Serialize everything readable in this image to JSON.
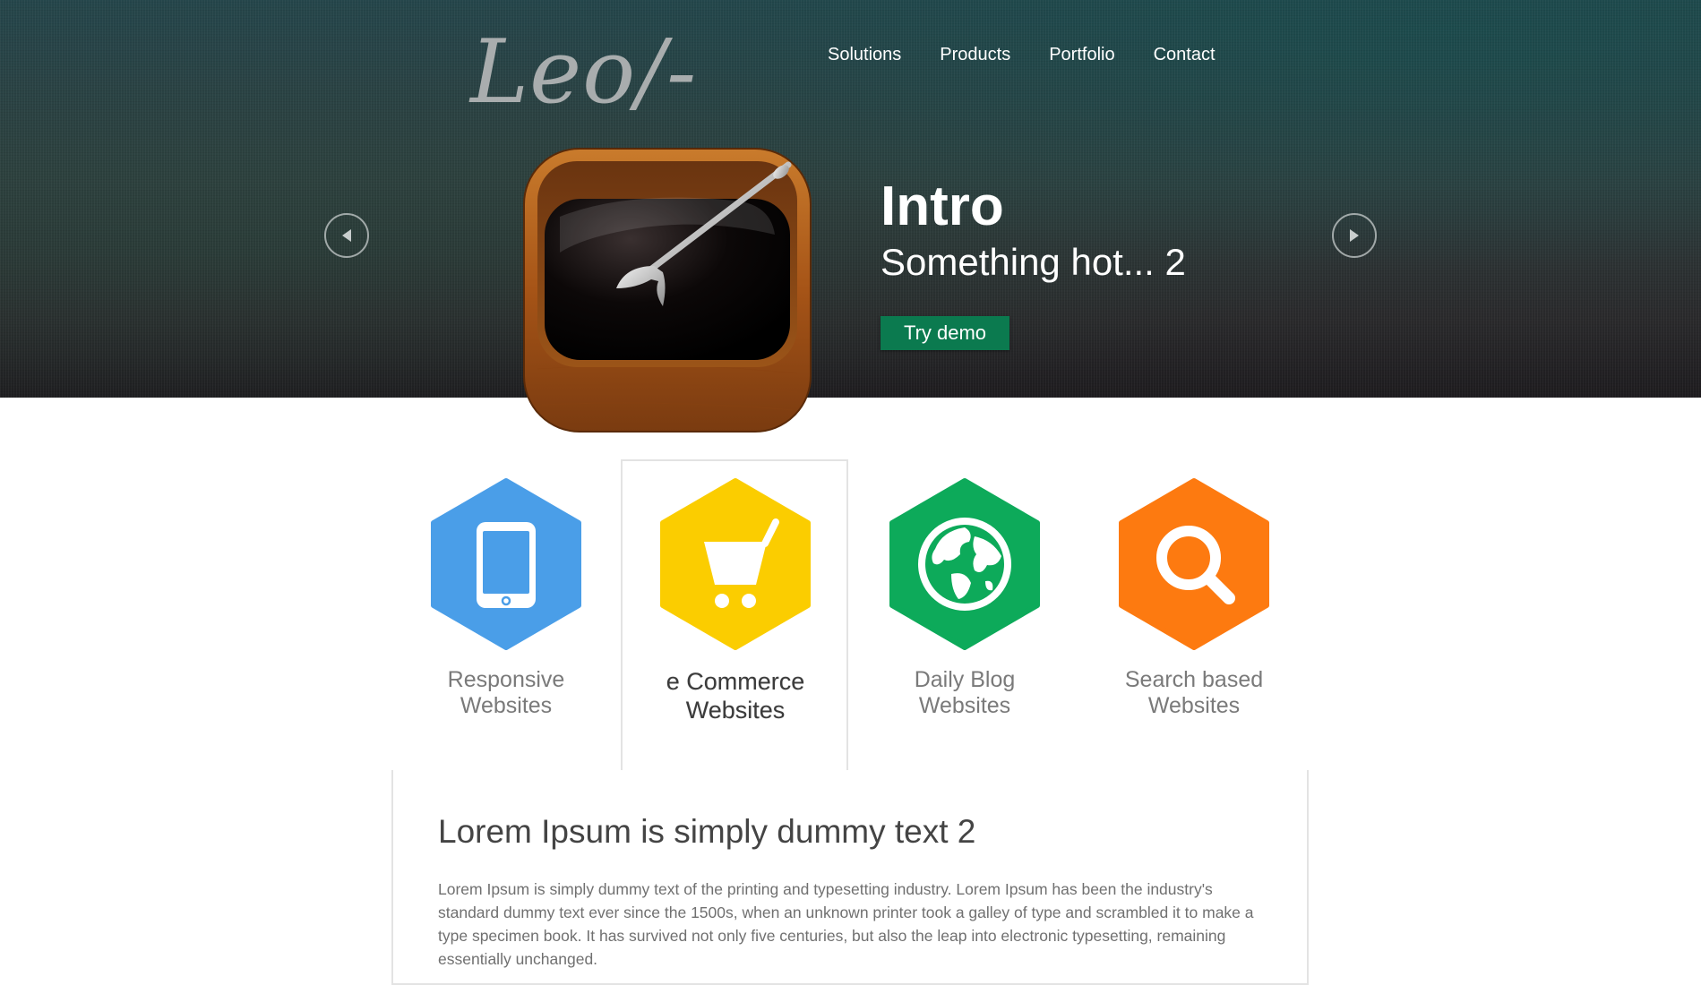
{
  "header": {
    "logo_text": "Leo/-",
    "nav": [
      "Solutions",
      "Products",
      "Portfolio",
      "Contact"
    ]
  },
  "slider": {
    "title": "Intro",
    "subtitle": "Something hot... 2",
    "cta_label": "Try demo",
    "prev_icon": "arrow-left-circle-icon",
    "next_icon": "arrow-right-circle-icon",
    "image_icon": "coffee-tray-app-icon"
  },
  "features": [
    {
      "line1": "Responsive",
      "line2": "Websites",
      "icon": "mobile-phone-icon",
      "color": "#4a9ee8"
    },
    {
      "line1": "e Commerce",
      "line2": "Websites",
      "icon": "shopping-cart-icon",
      "color": "#fbcd00"
    },
    {
      "line1": "Daily Blog",
      "line2": "Websites",
      "icon": "globe-icon",
      "color": "#0daa5a"
    },
    {
      "line1": "Search based",
      "line2": "Websites",
      "icon": "magnifier-icon",
      "color": "#fd7a10"
    }
  ],
  "content": {
    "title": "Lorem Ipsum is simply dummy text 2",
    "body": "Lorem Ipsum is simply dummy text of the printing and typesetting industry. Lorem Ipsum has been the industry's standard dummy text ever since the 1500s, when an unknown printer took a galley of type and scrambled it to make a type specimen book. It has survived not only five centuries, but also the leap into electronic typesetting, remaining essentially unchanged."
  },
  "colors": {
    "cta_background": "#0b7a4f",
    "border": "#e3e3e3"
  }
}
